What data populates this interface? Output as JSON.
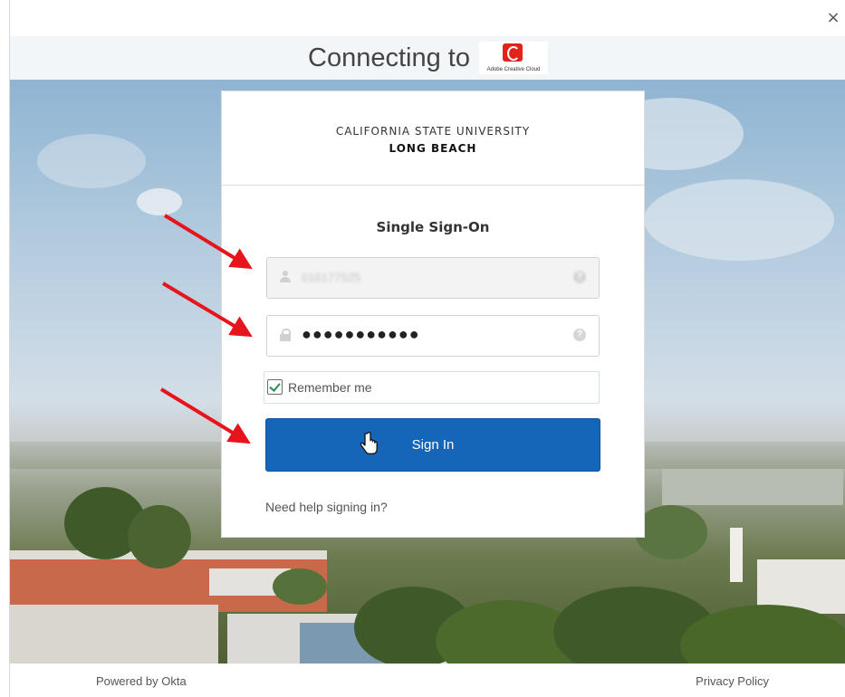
{
  "window": {
    "close_icon": "×"
  },
  "header": {
    "connecting_text": "Connecting to",
    "app_logo_text": "Adobe Creative Cloud"
  },
  "card": {
    "university_line1": "CALIFORNIA STATE UNIVERSITY",
    "university_line2": "LONG BEACH",
    "title": "Single Sign-On",
    "username_value": "016177525",
    "password_value": "●●●●●●●●●●●",
    "remember_label": "Remember me",
    "remember_checked": true,
    "signin_label": "Sign In",
    "help_link": "Need help signing in?",
    "help_icon_glyph": "?"
  },
  "footer": {
    "powered_by": "Powered by Okta",
    "privacy": "Privacy Policy"
  },
  "colors": {
    "primary_button": "#1565b8",
    "annotation_arrow": "#e8141b",
    "checkmark": "#2e8b57"
  },
  "icons": [
    "close-icon",
    "adobe-creative-cloud-logo",
    "user-icon",
    "lock-icon",
    "help-icon",
    "checkbox-check-icon",
    "hand-cursor-icon",
    "annotation-arrow"
  ]
}
